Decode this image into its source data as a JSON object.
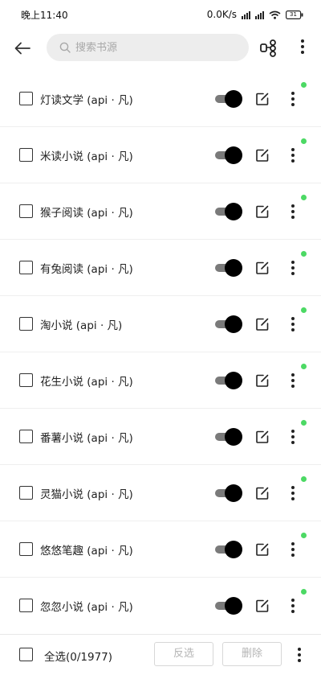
{
  "status_bar": {
    "time": "晚上11:40",
    "net_speed": "0.0K/s",
    "battery": "31"
  },
  "toolbar": {
    "search_placeholder": "搜索书源"
  },
  "colors": {
    "accent_green": "#4cd964",
    "switch_thumb": "#000000",
    "switch_track": "#7a7a7a",
    "search_bg": "#ededed"
  },
  "sources": [
    {
      "name": "灯读文学 (api · 凡)",
      "enabled": true,
      "checked": false
    },
    {
      "name": "米读小说 (api · 凡)",
      "enabled": true,
      "checked": false
    },
    {
      "name": "猴子阅读 (api · 凡)",
      "enabled": true,
      "checked": false
    },
    {
      "name": "有兔阅读 (api · 凡)",
      "enabled": true,
      "checked": false
    },
    {
      "name": "淘小说 (api · 凡)",
      "enabled": true,
      "checked": false
    },
    {
      "name": "花生小说 (api · 凡)",
      "enabled": true,
      "checked": false
    },
    {
      "name": "番薯小说 (api · 凡)",
      "enabled": true,
      "checked": false
    },
    {
      "name": "灵猫小说 (api · 凡)",
      "enabled": true,
      "checked": false
    },
    {
      "name": "悠悠笔趣 (api · 凡)",
      "enabled": true,
      "checked": false
    },
    {
      "name": "忽忽小说 (api · 凡)",
      "enabled": true,
      "checked": false
    }
  ],
  "bottom_bar": {
    "select_all_label": "全选(0/1977)",
    "invert_label": "反选",
    "delete_label": "删除"
  },
  "icons": {
    "back": "arrow-left-icon",
    "search": "search-icon",
    "group": "group-icon",
    "menu": "more-vertical-icon",
    "edit": "edit-icon"
  }
}
